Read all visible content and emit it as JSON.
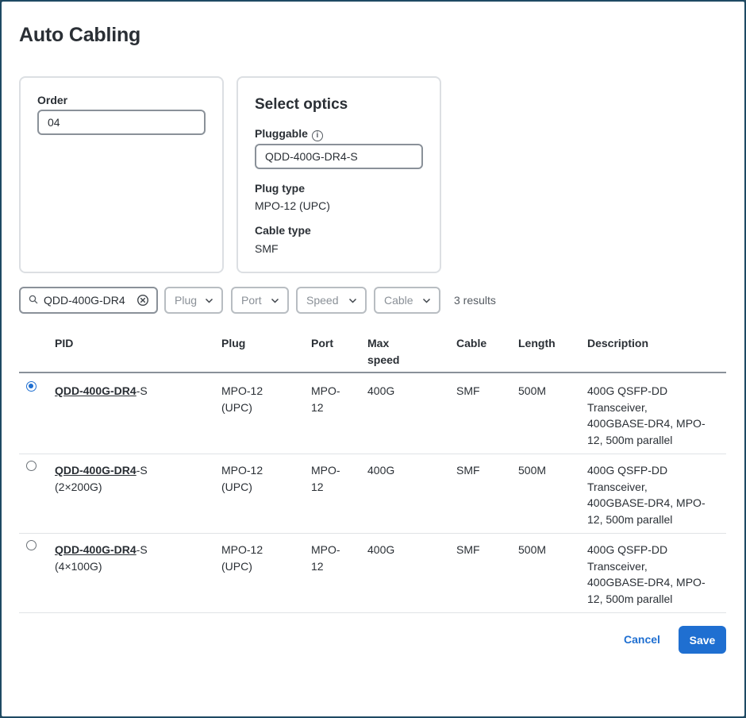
{
  "dialog": {
    "title": "Auto Cabling"
  },
  "order_card": {
    "label": "Order",
    "value": "04"
  },
  "optics_card": {
    "heading": "Select optics",
    "pluggable_label": "Pluggable",
    "pluggable_info_icon": "info-icon",
    "pluggable_value": "QDD-400G-DR4-S",
    "plug_type_label": "Plug type",
    "plug_type_value": "MPO-12 (UPC)",
    "cable_type_label": "Cable type",
    "cable_type_value": "SMF"
  },
  "filters": {
    "search_value": "QDD-400G-DR4",
    "search_icon": "search-icon",
    "clear_icon": "clear-icon",
    "plug": "Plug",
    "port": "Port",
    "speed": "Speed",
    "cable": "Cable",
    "results": "3 results"
  },
  "table": {
    "headers": {
      "pid": "PID",
      "plug": "Plug",
      "port": "Port",
      "max_speed_1": "Max",
      "max_speed_2": "speed",
      "cable": "Cable",
      "length": "Length",
      "description": "Description"
    },
    "rows": [
      {
        "selected": true,
        "pid_match": "QDD-400G-DR4",
        "pid_rest": "-S",
        "pid_sub": "",
        "plug_1": "MPO-12",
        "plug_2": "(UPC)",
        "port_1": "MPO-",
        "port_2": "12",
        "speed": "400G",
        "cable": "SMF",
        "length": "500M",
        "desc_1": "400G QSFP-DD",
        "desc_2": "Transceiver,",
        "desc_3": "400GBASE-DR4, MPO-",
        "desc_4": "12, 500m parallel"
      },
      {
        "selected": false,
        "pid_match": "QDD-400G-DR4",
        "pid_rest": "-S",
        "pid_sub": "(2×200G)",
        "plug_1": "MPO-12",
        "plug_2": "(UPC)",
        "port_1": "MPO-",
        "port_2": "12",
        "speed": "400G",
        "cable": "SMF",
        "length": "500M",
        "desc_1": "400G QSFP-DD",
        "desc_2": "Transceiver,",
        "desc_3": "400GBASE-DR4, MPO-",
        "desc_4": "12, 500m parallel"
      },
      {
        "selected": false,
        "pid_match": "QDD-400G-DR4",
        "pid_rest": "-S",
        "pid_sub": "(4×100G)",
        "plug_1": "MPO-12",
        "plug_2": "(UPC)",
        "port_1": "MPO-",
        "port_2": "12",
        "speed": "400G",
        "cable": "SMF",
        "length": "500M",
        "desc_1": "400G QSFP-DD",
        "desc_2": "Transceiver,",
        "desc_3": "400GBASE-DR4, MPO-",
        "desc_4": "12, 500m parallel"
      }
    ]
  },
  "footer": {
    "cancel": "Cancel",
    "save": "Save"
  },
  "colors": {
    "primary": "#1f6fd1",
    "border": "#8a9199"
  }
}
